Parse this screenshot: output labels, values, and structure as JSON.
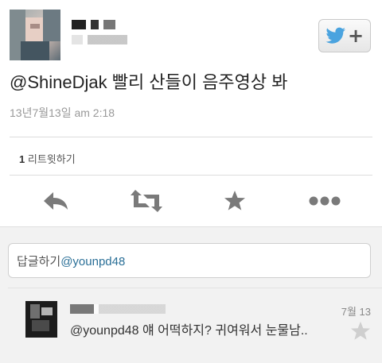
{
  "tweet": {
    "text": "@ShineDjak 빨리 산들이 음주영상 봐",
    "timestamp": "13년7월13일 am 2:18",
    "retweets": {
      "count": "1",
      "label": "리트윗하기"
    }
  },
  "follow_button": {
    "icon": "twitter-bird-icon",
    "plus": "+"
  },
  "actions": [
    {
      "name": "reply-action",
      "icon": "reply-arrow-icon"
    },
    {
      "name": "retweet-action",
      "icon": "retweet-icon"
    },
    {
      "name": "favorite-action",
      "icon": "star-icon"
    },
    {
      "name": "more-action",
      "icon": "more-dots-icon"
    }
  ],
  "reply_box": {
    "prefix": "답글하기",
    "mention": "@younpd48"
  },
  "reply_item": {
    "date": "7월 13",
    "text": "@younpd48 얘 어떡하지? 귀여워서 눈물남.."
  },
  "colors": {
    "accent_blue": "#4aa3df",
    "icon_gray": "#7a7a7a",
    "link_blue": "#2a6f97"
  }
}
